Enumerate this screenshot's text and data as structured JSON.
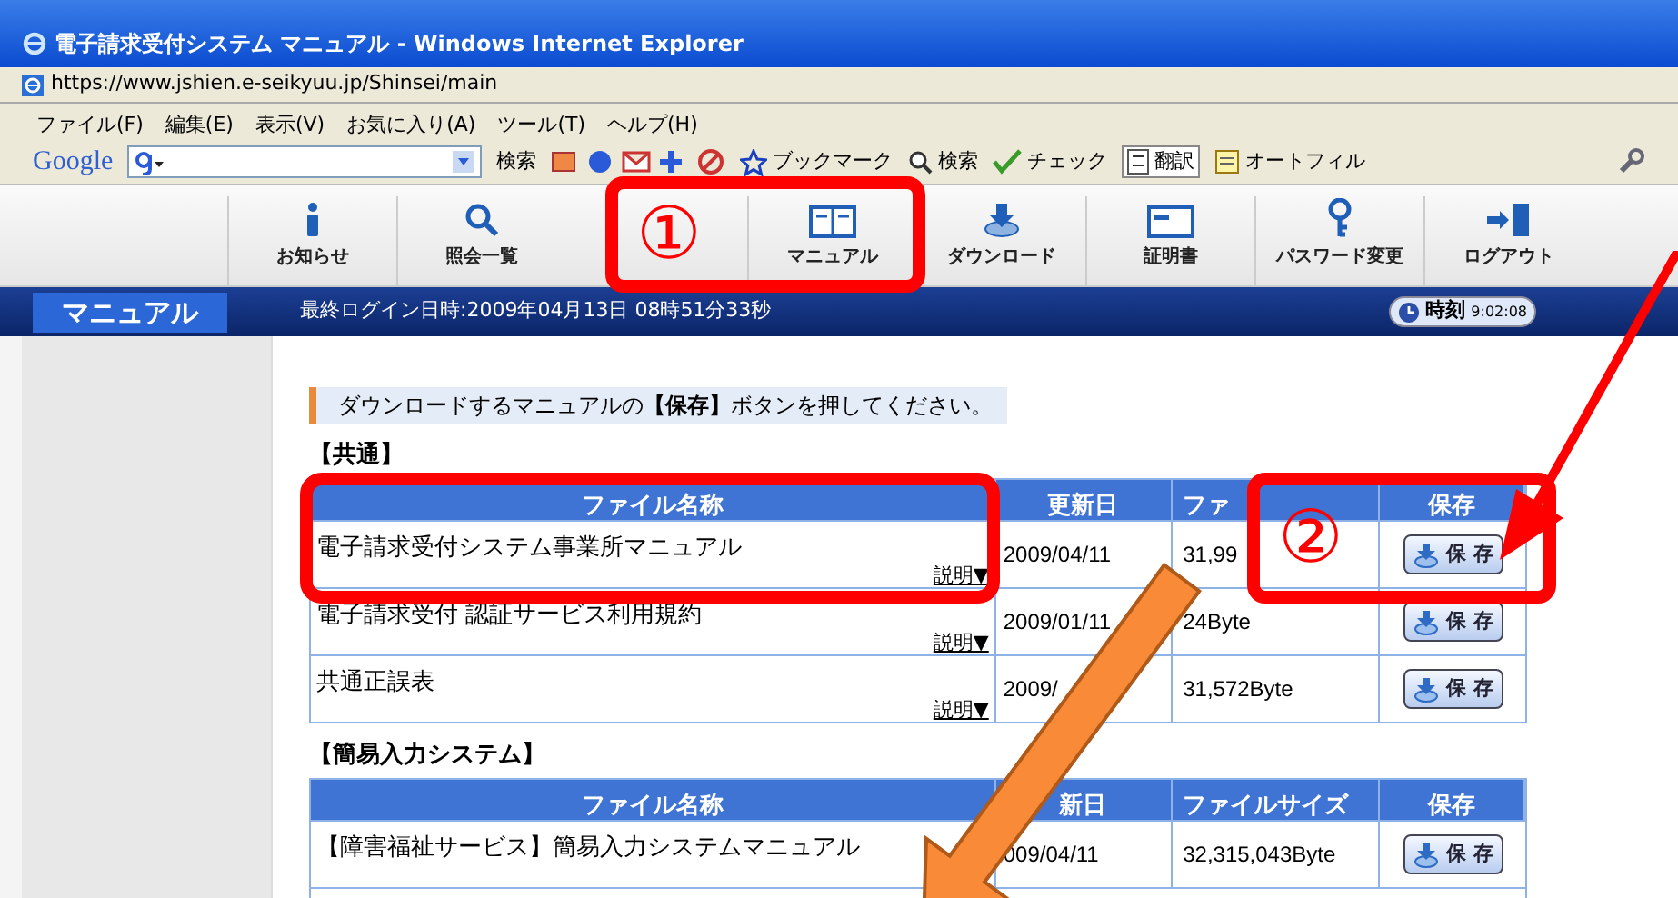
{
  "window": {
    "title": "電子請求受付システム マニュアル - Windows Internet Explorer"
  },
  "address_bar": {
    "url": "https://www.jshien.e-seikyuu.jp/Shinsei/main"
  },
  "menu_bar": [
    "ファイル(F)",
    "編集(E)",
    "表示(V)",
    "お気に入り(A)",
    "ツール(T)",
    "ヘルプ(H)"
  ],
  "google_toolbar": {
    "logo": "Google",
    "search_button": "検索",
    "items": [
      {
        "kind": "bookmark",
        "label": "ブックマーク"
      },
      {
        "kind": "search",
        "label": "検索"
      },
      {
        "kind": "check",
        "label": "チェック"
      },
      {
        "kind": "translate",
        "label": "翻訳"
      },
      {
        "kind": "autofill",
        "label": "オートフィル"
      }
    ]
  },
  "nav": {
    "items": [
      {
        "kind": "info",
        "label": "お知らせ"
      },
      {
        "kind": "search",
        "label": "照会一覧"
      },
      {
        "kind": "gap"
      },
      {
        "kind": "book",
        "label": "マニュアル"
      },
      {
        "kind": "download",
        "label": "ダウンロード"
      },
      {
        "kind": "certificate",
        "label": "証明書"
      },
      {
        "kind": "key",
        "label": "パスワード変更"
      },
      {
        "kind": "logout",
        "label": "ログアウト"
      }
    ]
  },
  "header_bar": {
    "section": "マニュアル",
    "last_login": "最終ログイン日時:2009年04月13日 08時51分33秒",
    "clock_label": "時刻",
    "clock_time": "9:02:08"
  },
  "instruction": "ダウンロードするマニュアルの**【保存】**ボタンを押してください。",
  "sections": [
    {
      "title": "【共通】",
      "columns": [
        "ファイル名称",
        "更新日",
        "ファ",
        "保存"
      ],
      "rows": [
        {
          "name": "電子請求受付システム事業所マニュアル",
          "info_link": "説明▼",
          "date": "2009/04/11",
          "size": "31,99",
          "save": "保 存"
        },
        {
          "name": "電子請求受付 認証サービス利用規約",
          "info_link": "説明▼",
          "date": "2009/01/11",
          "size": "24Byte",
          "save": "保 存"
        },
        {
          "name": "共通正誤表",
          "info_link": "説明▼",
          "date": "2009/",
          "size": "31,572Byte",
          "save": "保 存"
        }
      ]
    },
    {
      "title": "【簡易入力システム】",
      "columns": [
        "ファイル名称",
        "新日",
        "ファイルサイズ",
        "保存"
      ],
      "rows": [
        {
          "name": "【障害福祉サービス】簡易入力システムマニュアル",
          "date": "009/04/11",
          "size": "32,315,043Byte",
          "save": "保 存"
        }
      ]
    }
  ],
  "annotations": [
    {
      "kind": "marker",
      "label": "①"
    },
    {
      "kind": "marker",
      "label": "②"
    }
  ]
}
